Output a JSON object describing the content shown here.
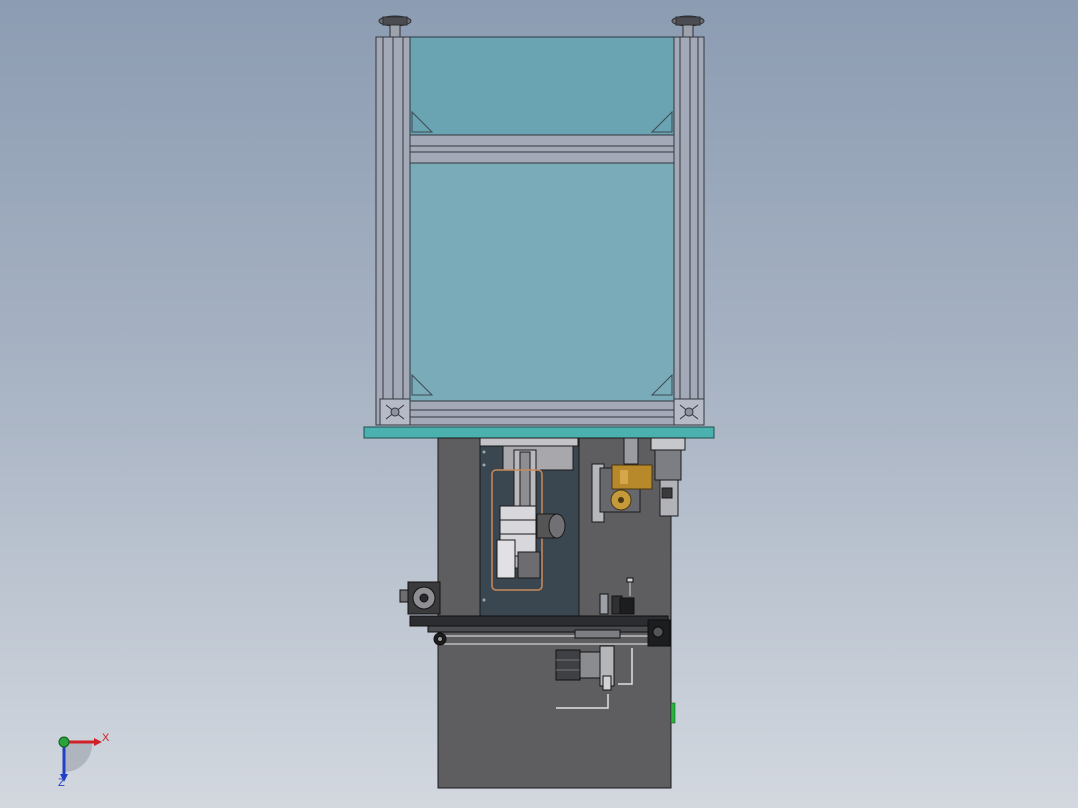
{
  "viewport": {
    "background_top": "#8c9cb2",
    "background_bottom": "#d3d8df"
  },
  "model": {
    "parts": [
      "leveling-foot-left",
      "leveling-foot-right",
      "aluminum-extrusion-frame",
      "glass-enclosure-upper",
      "glass-enclosure-lower",
      "teal-base-plate",
      "gray-lower-cabinet",
      "dark-mounting-panel",
      "linear-actuator",
      "brass-block",
      "servo-motor",
      "cooling-fan",
      "stepper-motor",
      "green-indicator"
    ],
    "colors": {
      "glass": "#7aabb8",
      "frame": "#a3a9b7",
      "base_plate": "#4bb1ae",
      "cabinet": "#5e5e60",
      "panel": "#3a4650",
      "brass": "#b8892a",
      "indicator": "#27b43c"
    }
  },
  "triad": {
    "x_label": "X",
    "z_label": "Z",
    "x_color": "#d0202a",
    "y_color": "#2aa43a",
    "z_color": "#2040c8"
  }
}
